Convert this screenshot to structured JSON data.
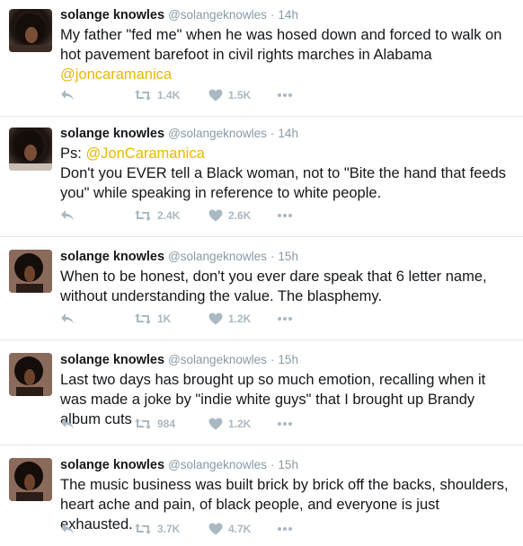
{
  "tweets": [
    {
      "name": "solange knowles",
      "handle": "@solangeknowles",
      "sep": "·",
      "time": "14h",
      "line_prefix": "",
      "prefix_mention": "",
      "text": "My father \"fed me\" when he was hosed down and forced to walk on hot pavement barefoot in civil rights marches in Alabama",
      "suffix_mention": "@joncaramanica",
      "retweets": "1.4K",
      "likes": "1.5K"
    },
    {
      "name": "solange knowles",
      "handle": "@solangeknowles",
      "sep": "·",
      "time": "14h",
      "line_prefix": "Ps:",
      "prefix_mention": "@JonCaramanica",
      "text": "Don't you EVER tell a Black woman, not to \"Bite the hand that feeds you\" while speaking in reference to white people.",
      "suffix_mention": "",
      "retweets": "2.4K",
      "likes": "2.6K"
    },
    {
      "name": "solange knowles",
      "handle": "@solangeknowles",
      "sep": "·",
      "time": "15h",
      "line_prefix": "",
      "prefix_mention": "",
      "text": "When to be honest, don't you ever dare speak that 6 letter name, without understanding the value. The blasphemy.",
      "suffix_mention": "",
      "retweets": "1K",
      "likes": "1.2K"
    },
    {
      "name": "solange knowles",
      "handle": "@solangeknowles",
      "sep": "·",
      "time": "15h",
      "line_prefix": "",
      "prefix_mention": "",
      "text": "Last two days has brought up so much emotion, recalling when it was made a joke by \"indie white guys\" that I brought up Brandy album cuts",
      "suffix_mention": "",
      "retweets": "984",
      "likes": "1.2K"
    },
    {
      "name": "solange knowles",
      "handle": "@solangeknowles",
      "sep": "·",
      "time": "15h",
      "line_prefix": "",
      "prefix_mention": "",
      "text": "The music business was built brick by brick off the backs, shoulders, heart ache and pain, of black people, and everyone is just exhausted.",
      "suffix_mention": "",
      "retweets": "3.7K",
      "likes": "4.7K"
    }
  ],
  "colors": {
    "mention": "#e6b800",
    "meta": "#8899a6",
    "action": "#aab8c2",
    "divider": "#e1e8ed"
  },
  "icons": [
    "reply-icon",
    "retweet-icon",
    "heart-icon",
    "more-icon"
  ]
}
